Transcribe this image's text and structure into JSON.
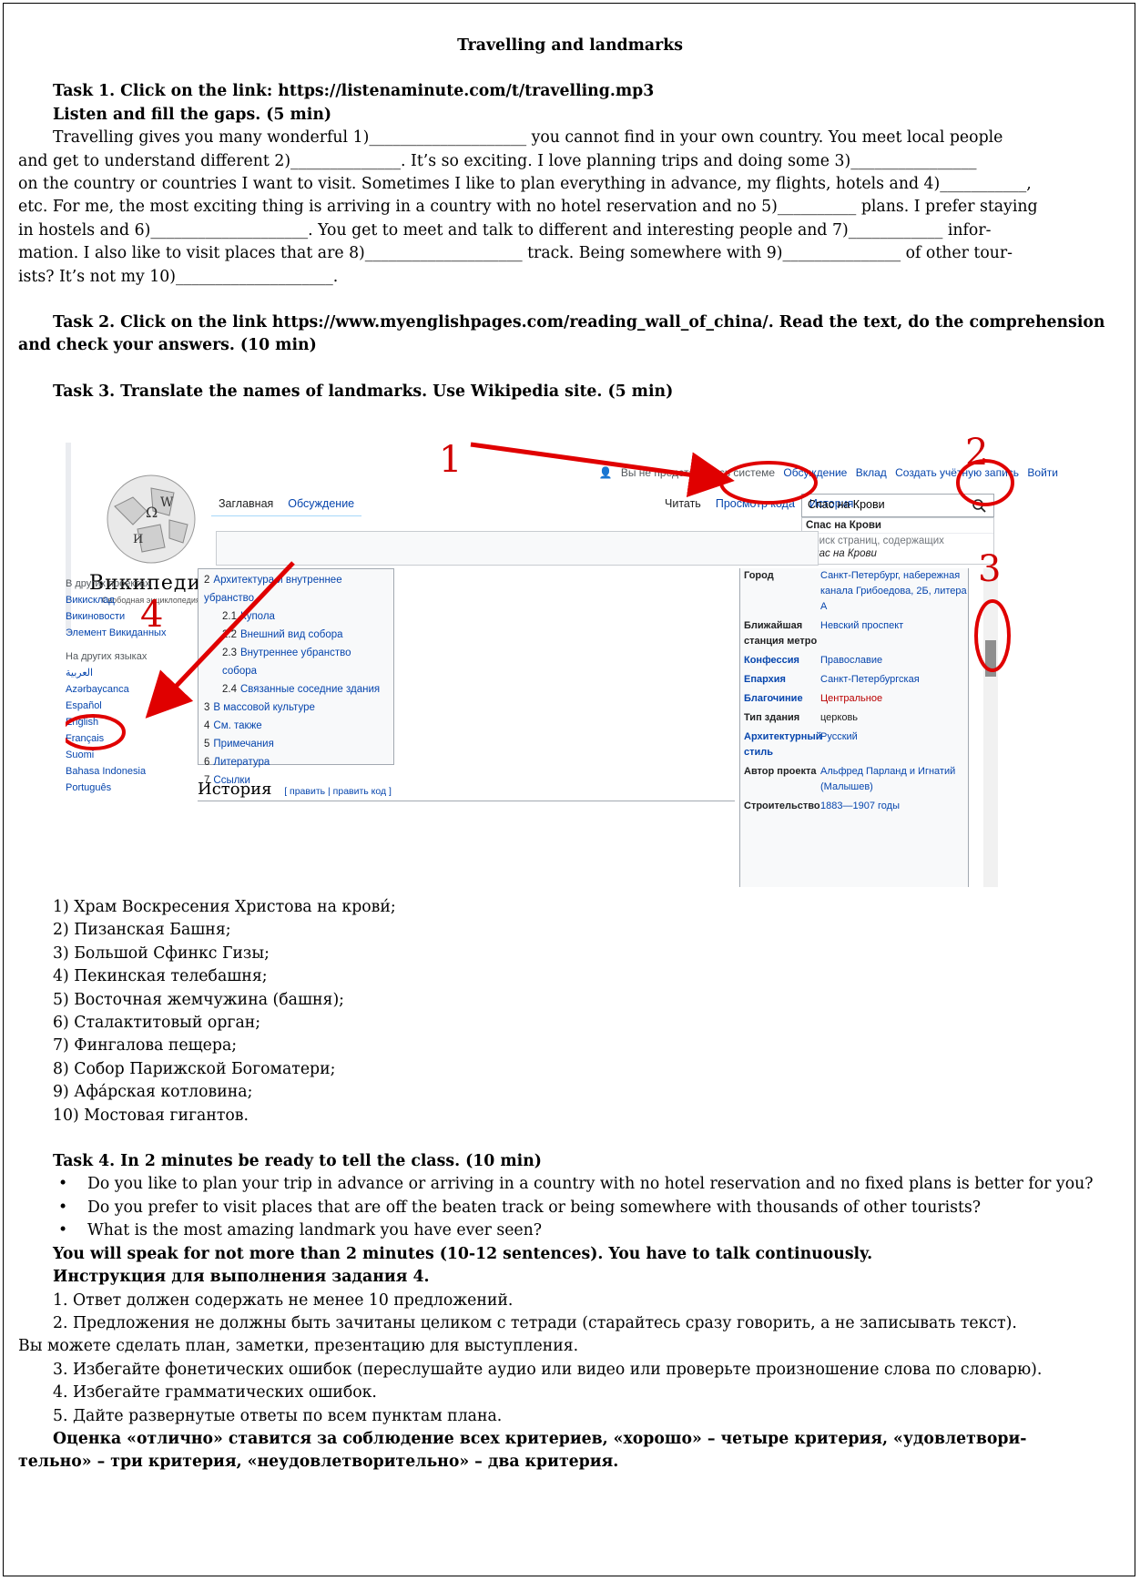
{
  "title": "Travelling and landmarks",
  "task1": {
    "heading": "Task 1. Click on the link: https://listenaminute.com/t/travelling.mp3",
    "subheading": "Listen and fill the gaps. (5 min)",
    "lines": [
      "Travelling gives you many wonderful 1)____________________ you cannot find in your own country. You meet local people",
      "and get to understand different 2)______________. It’s so exciting. I love planning trips and doing some 3)________________",
      "on the country or countries I want to visit. Sometimes I like to plan everything in advance, my flights, hotels and 4)___________,",
      "etc. For me, the most exciting thing is arriving in a country with no hotel reservation and no 5)__________ plans. I prefer staying",
      "in hostels and 6)____________________. You get to meet and talk to different and interesting people and 7)____________ infor-",
      "mation. I also like to visit places that are 8)____________________ track. Being somewhere with 9)_______________ of other tour-",
      "ists? It’s not my 10)____________________."
    ]
  },
  "task2": {
    "line1": "Task 2. Click on the link https://www.myenglishpages.com/reading_wall_of_china/. Read the text, do the comprehension",
    "line2": "and check your answers. (10 min)"
  },
  "task3": {
    "heading": "Task 3. Translate the names of landmarks. Use Wikipedia site. (5 min)"
  },
  "screenshot": {
    "logo_text": "ВикипедиЯ",
    "logo_sub": "Свободная энциклопедия",
    "user_nav": [
      "Вы не представились системе",
      "Обсуждение",
      "Вклад",
      "Создать учётную запись",
      "Войти"
    ],
    "tabs_left": [
      "Заглавная",
      "Обсуждение"
    ],
    "tabs_right": [
      "Читать",
      "Просмотр кода",
      "История"
    ],
    "search_value": "Спас на Крови",
    "suggestions": [
      "Спас на Крови",
      "Поиск страниц, содержащих",
      "Спас на Крови"
    ],
    "sidebar": {
      "heading1": "В других проектах",
      "projects": [
        "Викисклад",
        "Викиновости",
        "Элемент Викиданных"
      ],
      "heading2": "На других языках",
      "languages": [
        "العربية",
        "Azərbaycanca",
        "Español",
        "English",
        "Français",
        "Suomi",
        "Bahasa Indonesia",
        "Português"
      ]
    },
    "toc": [
      {
        "num": "2",
        "label": "Архитектура и внутреннее убранство",
        "sub": false
      },
      {
        "num": "2.1",
        "label": "Купола",
        "sub": true
      },
      {
        "num": "2.2",
        "label": "Внешний вид собора",
        "sub": true
      },
      {
        "num": "2.3",
        "label": "Внутреннее убранство собора",
        "sub": true
      },
      {
        "num": "2.4",
        "label": "Связанные соседние здания",
        "sub": true
      },
      {
        "num": "3",
        "label": "В массовой культуре",
        "sub": false
      },
      {
        "num": "4",
        "label": "См. также",
        "sub": false
      },
      {
        "num": "5",
        "label": "Примечания",
        "sub": false
      },
      {
        "num": "6",
        "label": "Литература",
        "sub": false
      },
      {
        "num": "7",
        "label": "Ссылки",
        "sub": false
      }
    ],
    "history_heading": "История",
    "history_edit": "[ править | править код ]",
    "infobox": [
      {
        "k": "Город",
        "v": "Санкт-Петербург, набережная канала Грибоедова, 2Б, литера А",
        "kclass": "",
        "vclass": ""
      },
      {
        "k": "Ближайшая станция метро",
        "v": "Невский проспект",
        "kclass": "",
        "vclass": ""
      },
      {
        "k": "Конфессия",
        "v": "Православие",
        "kclass": "link",
        "vclass": ""
      },
      {
        "k": "Епархия",
        "v": "Санкт-Петербургская",
        "kclass": "link",
        "vclass": ""
      },
      {
        "k": "Благочиние",
        "v": "Центральное",
        "kclass": "link",
        "vclass": "red"
      },
      {
        "k": "Тип здания",
        "v": "церковь",
        "kclass": "",
        "vclass": "dark"
      },
      {
        "k": "Архитектурный стиль",
        "v": "Русский",
        "kclass": "link",
        "vclass": ""
      },
      {
        "k": "Автор проекта",
        "v": "Альфред Парланд и Игнатий (Малышев)",
        "kclass": "",
        "vclass": ""
      },
      {
        "k": "Строительство",
        "v": "1883—1907 годы",
        "kclass": "",
        "vclass": ""
      }
    ],
    "annotations": [
      "1",
      "2",
      "3",
      "4"
    ]
  },
  "landmarks": [
    "1) Храм Воскресения Христова на крови́;",
    "2) Пизанская Башня;",
    "3) Большой Сфинкс Гизы;",
    "4) Пекинская телебашня;",
    "5) Восточная жемчужина (башня);",
    "6) Сталактитовый орган;",
    "7) Фингалова пещера;",
    "8) Собор Парижской Богоматери;",
    "9) Афáрская котловина;",
    "10) Мостовая гигантов."
  ],
  "task4": {
    "heading": "Task 4. In 2 minutes be ready to tell the class. (10 min)",
    "bullets": [
      "Do you like to plan your trip in advance or arriving in a country with no hotel reservation and no fixed plans is better for you?",
      "Do you prefer to visit places that are off the beaten track or being somewhere with thousands of other tourists?",
      "What is the most amazing landmark you have ever seen?"
    ],
    "speak": "You will speak for not more than 2 minutes (10-12 sentences). You have to talk continuously.",
    "instr_heading": "Инструкция для выполнения задания 4.",
    "instr1": "1. Ответ должен содержать не менее 10 предложений.",
    "instr2a": "2. Предложения не должны быть зачитаны целиком с тетради (старайтесь сразу говорить, а не записывать текст).",
    "instr2b": "Вы можете сделать план, заметки, презентацию для выступления.",
    "instr3": "3. Избегайте фонетических ошибок (переслушайте аудио или видео или проверьте произношение слова по словарю).",
    "instr4": "4. Избегайте грамматических ошибок.",
    "instr5": "5. Дайте развернутые ответы по всем пунктам плана.",
    "grade1": "Оценка «отлично» ставится за соблюдение всех критериев, «хорошо» – четыре критерия, «удовлетвори-",
    "grade2": "тельно» – три критерия, «неудовлетворительно» – два критерия."
  }
}
